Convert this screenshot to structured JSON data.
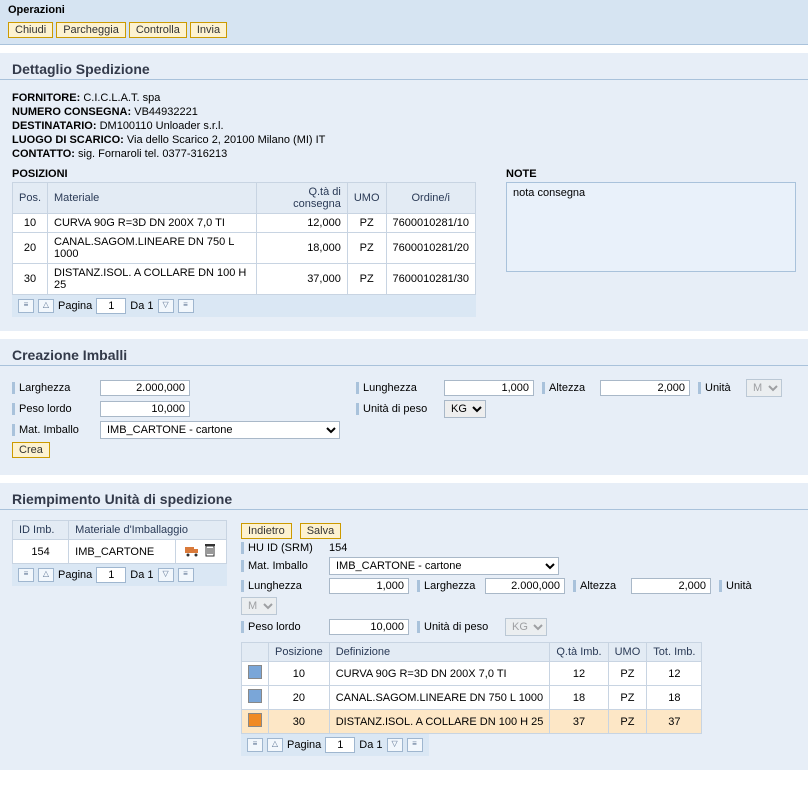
{
  "header": {
    "title": "Operazioni",
    "buttons": {
      "close": "Chiudi",
      "park": "Parcheggia",
      "check": "Controlla",
      "send": "Invia"
    }
  },
  "detail": {
    "title": "Dettaglio Spedizione",
    "supplier_lbl": "FORNITORE:",
    "supplier_val": "C.I.C.L.A.T. spa",
    "delivery_lbl": "NUMERO CONSEGNA:",
    "delivery_val": "VB44932221",
    "dest_lbl": "DESTINATARIO:",
    "dest_val": "DM100110 Unloader s.r.l.",
    "unload_lbl": "LUOGO DI SCARICO:",
    "unload_val": "Via dello Scarico 2, 20100 Milano (MI) IT",
    "contact_lbl": "CONTATTO:",
    "contact_val": "sig. Fornaroli tel. 0377-316213",
    "positions_title": "POSIZIONI",
    "note_title": "NOTE",
    "note_text": "nota consegna",
    "cols": {
      "pos": "Pos.",
      "mat": "Materiale",
      "qty": "Q.tà di consegna",
      "umo": "UMO",
      "ord": "Ordine/i"
    },
    "rows": [
      {
        "pos": "10",
        "mat": "CURVA 90G R=3D DN 200X 7,0 TI",
        "qty": "12,000",
        "umo": "PZ",
        "ord": "7600010281/10"
      },
      {
        "pos": "20",
        "mat": "CANAL.SAGOM.LINEARE DN 750 L 1000",
        "qty": "18,000",
        "umo": "PZ",
        "ord": "7600010281/20"
      },
      {
        "pos": "30",
        "mat": "DISTANZ.ISOL. A COLLARE DN 100 H 25",
        "qty": "37,000",
        "umo": "PZ",
        "ord": "7600010281/30"
      }
    ]
  },
  "paginator": {
    "page_lbl": "Pagina",
    "page_val": "1",
    "of_lbl": "Da 1"
  },
  "imballi": {
    "title": "Creazione Imballi",
    "width_lbl": "Larghezza",
    "width_val": "2.000,000",
    "length_lbl": "Lunghezza",
    "length_val": "1,000",
    "height_lbl": "Altezza",
    "height_val": "2,000",
    "unit_lbl": "Unità",
    "unit_val": "M",
    "gross_lbl": "Peso lordo",
    "gross_val": "10,000",
    "wunit_lbl": "Unità di peso",
    "wunit_val": "KG",
    "mat_lbl": "Mat. Imballo",
    "mat_val": "IMB_CARTONE - cartone",
    "create_btn": "Crea"
  },
  "riemp": {
    "title": "Riempimento Unità di spedizione",
    "left_cols": {
      "id": "ID Imb.",
      "mat": "Materiale d'Imballaggio"
    },
    "left_row": {
      "id": "154",
      "mat": "IMB_CARTONE"
    },
    "back_btn": "Indietro",
    "save_btn": "Salva",
    "huid_lbl": "HU ID (SRM)",
    "huid_val": "154",
    "mat_lbl": "Mat. Imballo",
    "mat_val": "IMB_CARTONE - cartone",
    "length_lbl": "Lunghezza",
    "length_val": "1,000",
    "width_lbl": "Larghezza",
    "width_val": "2.000,000",
    "height_lbl": "Altezza",
    "height_val": "2,000",
    "unit_lbl": "Unità",
    "unit_val": "M",
    "gross_lbl": "Peso lordo",
    "gross_val": "10,000",
    "wunit_lbl": "Unità di peso",
    "wunit_val": "KG",
    "fill_cols": {
      "pos": "Posizione",
      "def": "Definizione",
      "qty": "Q.tà Imb.",
      "umo": "UMO",
      "tot": "Tot. Imb."
    },
    "fill_rows": [
      {
        "color": "#7aa6d8",
        "pos": "10",
        "def": "CURVA 90G R=3D DN 200X 7,0 TI",
        "qty": "12",
        "umo": "PZ",
        "tot": "12",
        "hl": false
      },
      {
        "color": "#7aa6d8",
        "pos": "20",
        "def": "CANAL.SAGOM.LINEARE DN 750 L 1000",
        "qty": "18",
        "umo": "PZ",
        "tot": "18",
        "hl": false
      },
      {
        "color": "#f08a24",
        "pos": "30",
        "def": "DISTANZ.ISOL. A COLLARE DN 100 H 25",
        "qty": "37",
        "umo": "PZ",
        "tot": "37",
        "hl": true
      }
    ]
  }
}
